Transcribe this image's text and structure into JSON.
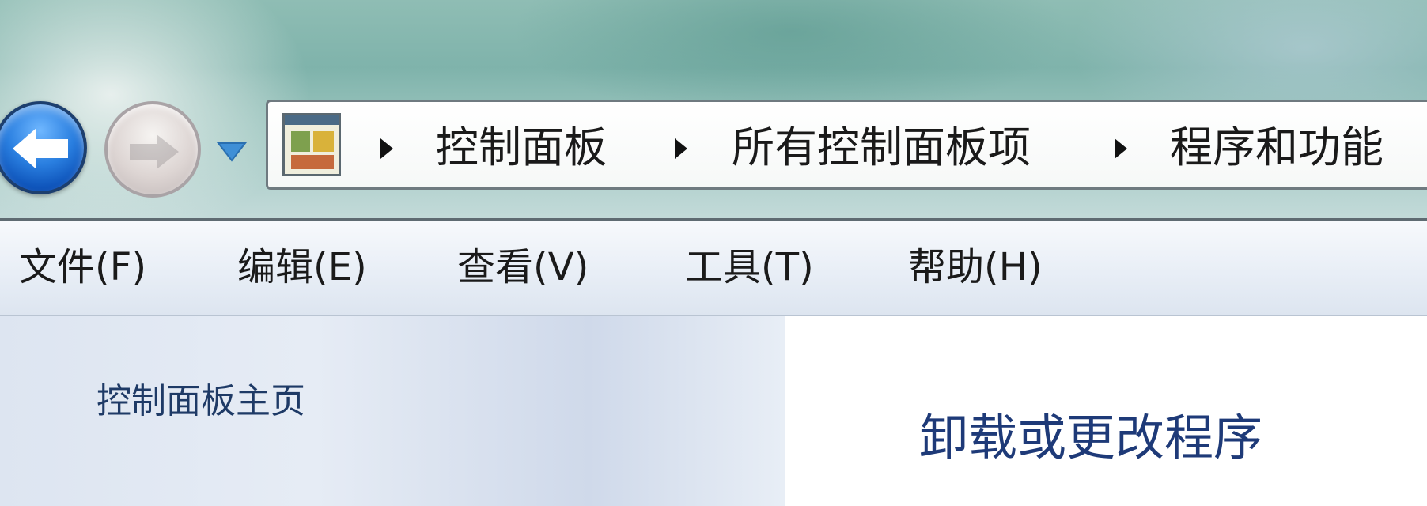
{
  "navigation": {
    "back_icon": "back-arrow-icon",
    "forward_icon": "forward-arrow-icon",
    "recent_pages_icon": "chevron-down-icon"
  },
  "address_bar": {
    "location_icon": "control-panel-icon",
    "breadcrumbs": [
      "控制面板",
      "所有控制面板项",
      "程序和功能"
    ]
  },
  "menubar": {
    "items": [
      "文件(F)",
      "编辑(E)",
      "查看(V)",
      "工具(T)",
      "帮助(H)"
    ]
  },
  "sidebar": {
    "home_link": "控制面板主页"
  },
  "main": {
    "title": "卸载或更改程序"
  },
  "colors": {
    "back_button": "#2a7fe0",
    "link_text": "#1e3a66",
    "title_text": "#1e3a78"
  }
}
